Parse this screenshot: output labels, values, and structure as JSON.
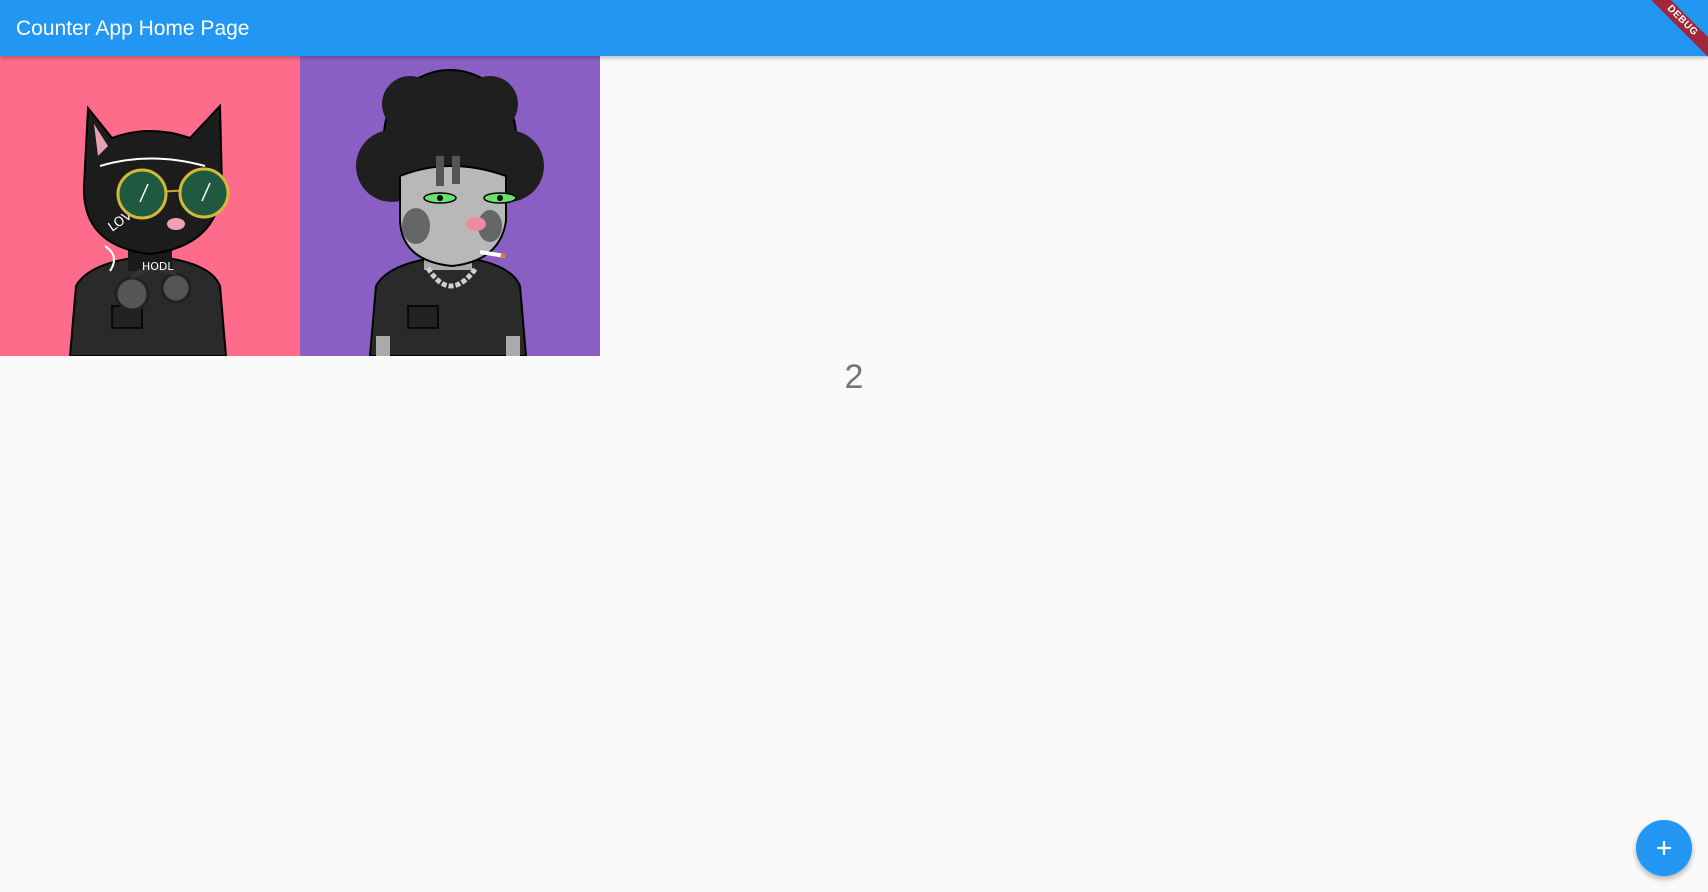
{
  "app_bar": {
    "title": "Counter App Home Page",
    "debug_label": "DEBUG",
    "color": "#2196f3"
  },
  "grid": {
    "images": [
      {
        "name": "cat-nft-black-sunglasses",
        "background": "#ff6b8a"
      },
      {
        "name": "cat-nft-gray-afro",
        "background": "#8a5fc4"
      }
    ]
  },
  "counter": {
    "value": "2"
  },
  "fab": {
    "icon": "plus-icon",
    "color": "#2196f3"
  }
}
